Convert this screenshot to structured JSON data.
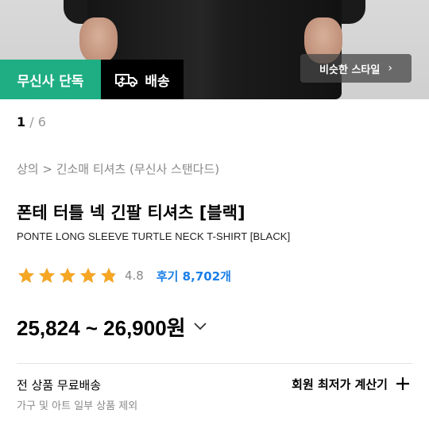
{
  "photo": {
    "alt": "product-photo"
  },
  "badges": {
    "exclusive": "무신사 단독",
    "delivery": "배송"
  },
  "similar_style": "비슷한 스타일",
  "pager": {
    "current": "1",
    "separator": " / ",
    "total": "6"
  },
  "breadcrumb": "상의 > 긴소매 티셔츠 (무신사 스탠다드)",
  "product": {
    "title_ko": "폰테 터틀 넥 긴팔 티셔츠 [블랙]",
    "title_en": "PONTE LONG SLEEVE TURTLE NECK T-SHIRT [BLACK]",
    "rating": "4.8",
    "rating_stars": 4.8,
    "reviews": "후기 8,702개",
    "price_range": "25,824 ~ 26,900원"
  },
  "shipping": {
    "title": "전 상품 무료배송",
    "subtitle": "가구 및 아트 일부 상품 제외"
  },
  "calculator": {
    "label": "회원 최저가 계산기"
  },
  "colors": {
    "brand_green": "#1fae83",
    "star": "#f5a623",
    "link_blue": "#1a7fe8"
  }
}
